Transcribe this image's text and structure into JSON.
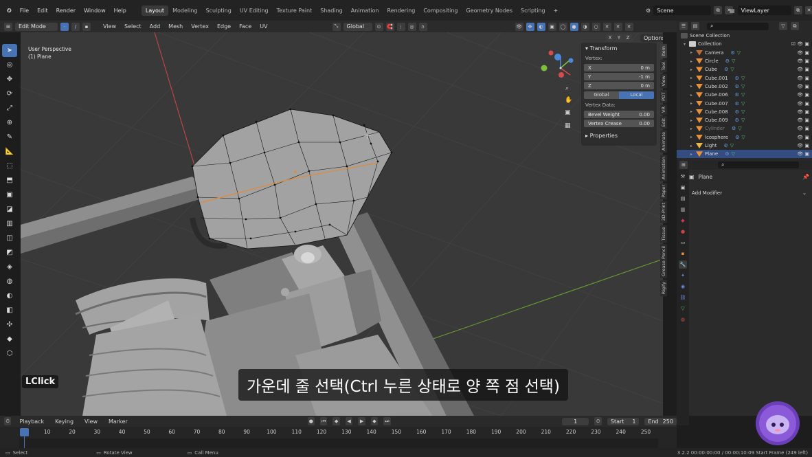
{
  "menu": [
    "File",
    "Edit",
    "Render",
    "Window",
    "Help"
  ],
  "workspaces": [
    "Layout",
    "Modeling",
    "Sculpting",
    "UV Editing",
    "Texture Paint",
    "Shading",
    "Animation",
    "Rendering",
    "Compositing",
    "Geometry Nodes",
    "Scripting"
  ],
  "active_workspace": "Layout",
  "scene": "Scene",
  "view_layer": "ViewLayer",
  "header": {
    "mode": "Edit Mode",
    "menus": [
      "View",
      "Select",
      "Add",
      "Mesh",
      "Vertex",
      "Edge",
      "Face",
      "UV"
    ],
    "orientation": "Global",
    "axes": [
      "X",
      "Y",
      "Z"
    ],
    "options": "Options"
  },
  "viewport": {
    "perspective": "User Perspective",
    "object": "(1) Plane"
  },
  "npanel": {
    "section": "Transform",
    "vertex_label": "Vertex:",
    "fields": [
      {
        "k": "X",
        "v": "0 m"
      },
      {
        "k": "Y",
        "v": "-1 m"
      },
      {
        "k": "Z",
        "v": "0 m"
      }
    ],
    "global": "Global",
    "local": "Local",
    "vertex_data": "Vertex Data:",
    "bevel": {
      "k": "Bevel Weight",
      "v": "0.00"
    },
    "crease": {
      "k": "Vertex Crease",
      "v": "0.00"
    },
    "properties": "Properties"
  },
  "side_tabs": [
    "Item",
    "Tool",
    "View",
    "PDT",
    "VR",
    "Edit",
    "Animate",
    "Animation",
    "Paper",
    "3D-Print",
    "Tissue",
    "Grease Pencil",
    "Rigify"
  ],
  "outliner": {
    "root": "Scene Collection",
    "collection": "Collection",
    "items": [
      {
        "name": "Camera",
        "type": "camera"
      },
      {
        "name": "Circle",
        "type": "mesh"
      },
      {
        "name": "Cube",
        "type": "mesh"
      },
      {
        "name": "Cube.001",
        "type": "mesh"
      },
      {
        "name": "Cube.002",
        "type": "mesh"
      },
      {
        "name": "Cube.006",
        "type": "mesh"
      },
      {
        "name": "Cube.007",
        "type": "mesh"
      },
      {
        "name": "Cube.008",
        "type": "mesh"
      },
      {
        "name": "Cube.009",
        "type": "mesh"
      },
      {
        "name": "Cylinder",
        "type": "mesh",
        "dim": true
      },
      {
        "name": "Icosphere",
        "type": "mesh"
      },
      {
        "name": "Light",
        "type": "light"
      },
      {
        "name": "Plane",
        "type": "mesh",
        "selected": true
      }
    ]
  },
  "properties": {
    "object": "Plane",
    "add_modifier": "Add Modifier"
  },
  "timeline": {
    "menus": [
      "Playback",
      "Keying",
      "View",
      "Marker"
    ],
    "current_frame": "1",
    "start_label": "Start",
    "start": "1",
    "end_label": "End",
    "end": "250",
    "ticks": [
      "1",
      "10",
      "20",
      "30",
      "40",
      "50",
      "60",
      "70",
      "80",
      "90",
      "100",
      "110",
      "120",
      "130",
      "140",
      "150",
      "160",
      "170",
      "180",
      "190",
      "200",
      "210",
      "220",
      "230",
      "240",
      "250"
    ]
  },
  "status": {
    "select": "Select",
    "rotate": "Rotate View",
    "call": "Call Menu",
    "info": "3.2.2 00:00:00:00 / 00:00:10:09 Start Frame (249 left)"
  },
  "subtitle": "가운데 줄 선택(Ctrl 누른 상태로 양 쪽 점 선택)",
  "key_hint": "LClick",
  "colors": {
    "accent": "#4772b3",
    "viewport": "#393939",
    "mesh": "#9a9a9a",
    "x_axis": "#e05a5a",
    "y_axis": "#7fbf3a",
    "z_axis": "#4a8ad8"
  }
}
